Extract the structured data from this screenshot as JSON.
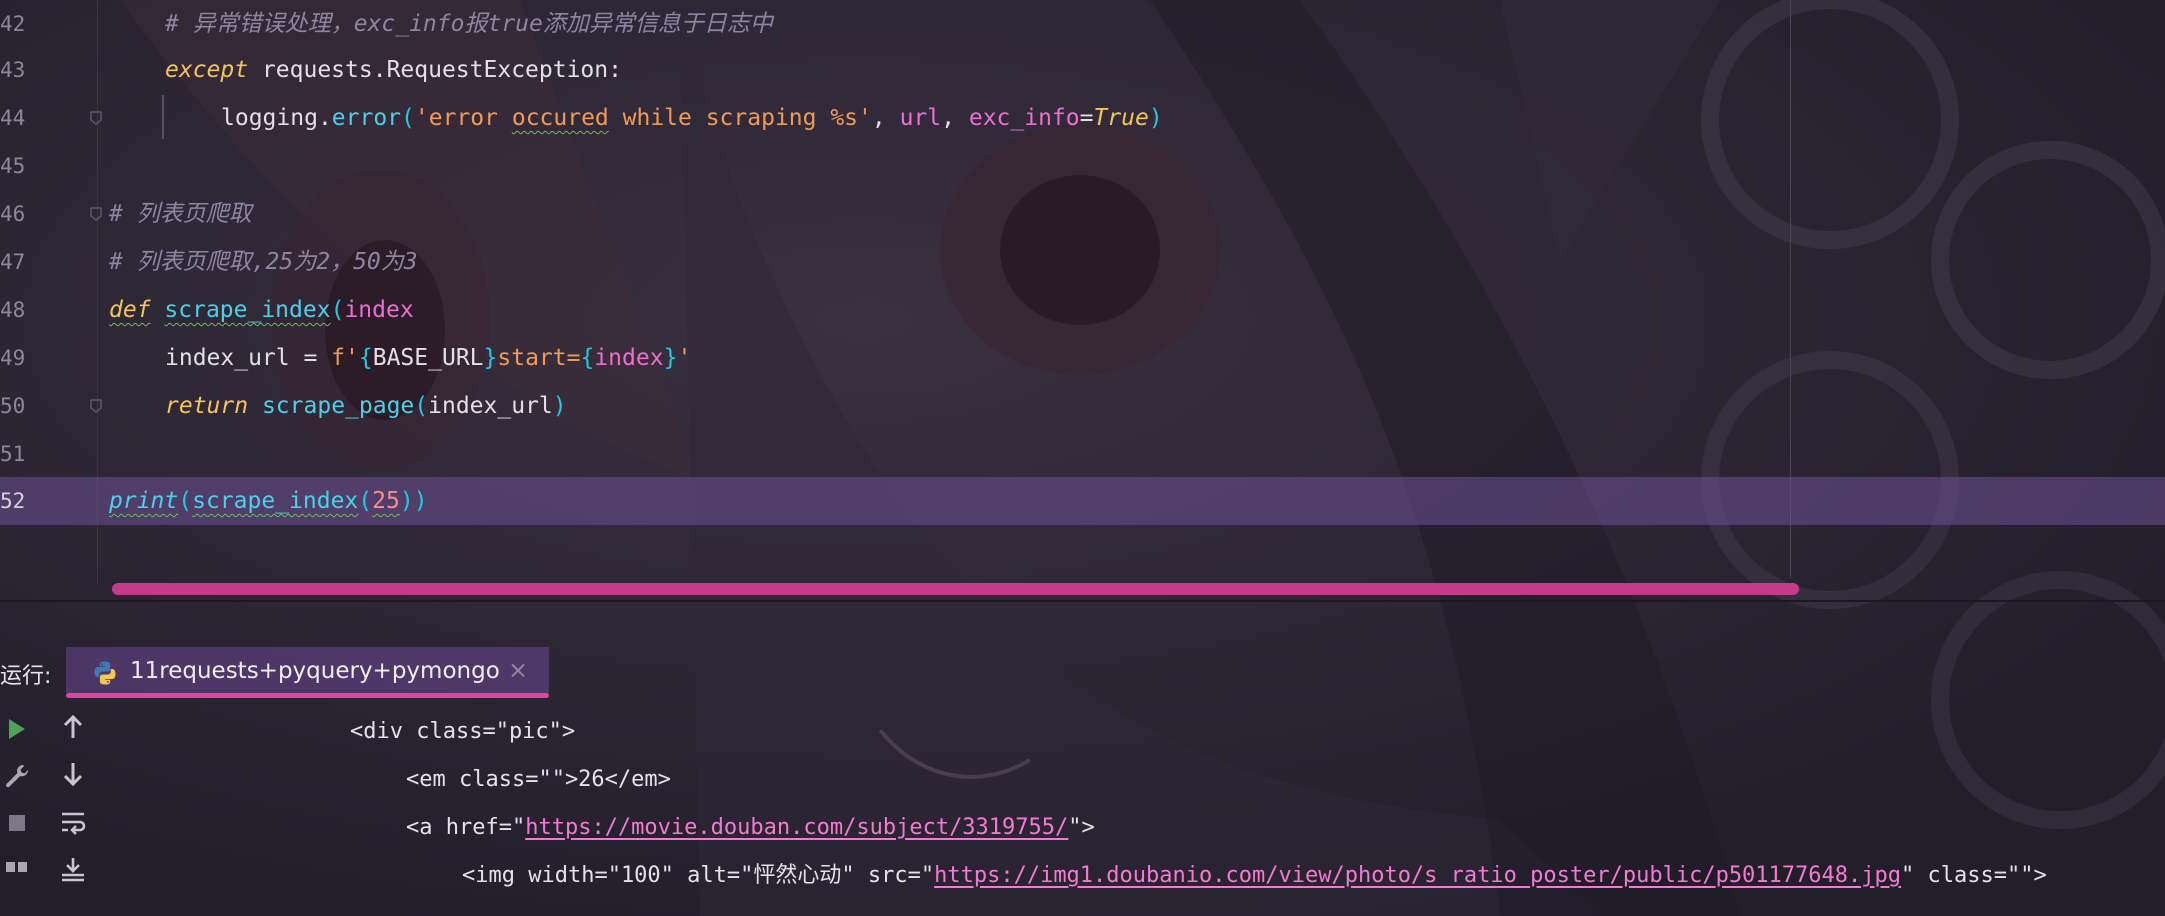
{
  "editor": {
    "lines": [
      {
        "num": "42",
        "tokens": [
          [
            "# 异常错误处理，exc_info报true添加异常信息于日志中",
            "cm"
          ]
        ]
      },
      {
        "num": "43",
        "tokens": [
          [
            "except",
            "kw"
          ],
          [
            " requests.RequestException",
            "tx"
          ],
          [
            ":",
            "pn"
          ]
        ]
      },
      {
        "num": "44",
        "tokens": [
          [
            "logging",
            "tx"
          ],
          [
            ".",
            "pn"
          ],
          [
            "error",
            "fn"
          ],
          [
            "(",
            "br"
          ],
          [
            "'error ",
            "st"
          ],
          [
            "occured",
            "st-sq"
          ],
          [
            " while scraping %s'",
            "st"
          ],
          [
            ", ",
            "pn"
          ],
          [
            "url",
            "ex"
          ],
          [
            ", ",
            "pn"
          ],
          [
            "exc_info",
            "ex"
          ],
          [
            "=",
            "pn"
          ],
          [
            "True",
            "tr"
          ],
          [
            ")",
            "br"
          ]
        ]
      },
      {
        "num": "45",
        "tokens": []
      },
      {
        "num": "46",
        "tokens": [
          [
            "# 列表页爬取",
            "cm"
          ]
        ]
      },
      {
        "num": "47",
        "tokens": [
          [
            "# 列表页爬取,25为2，50为3",
            "cm"
          ]
        ]
      },
      {
        "num": "48",
        "tokens": [
          [
            "def",
            "kw-sq"
          ],
          [
            " ",
            "tx"
          ],
          [
            "scrape_index",
            "fn-sq"
          ],
          [
            "(",
            "br"
          ],
          [
            "index",
            "ex"
          ],
          ")",
          "br"
        ]
      },
      {
        "num": "49",
        "tokens": [
          [
            "index_url = ",
            "tx"
          ],
          [
            "f'",
            "st"
          ],
          [
            "{",
            "br"
          ],
          [
            "BASE_URL",
            "tx"
          ],
          [
            "}",
            "br"
          ],
          [
            "start=",
            "st"
          ],
          [
            "{",
            "br"
          ],
          [
            "index",
            "ex"
          ],
          [
            "}",
            "br"
          ],
          [
            "'",
            "st"
          ]
        ]
      },
      {
        "num": "50",
        "tokens": [
          [
            "return",
            "kw"
          ],
          [
            " ",
            "tx"
          ],
          [
            "scrape_page",
            "fn"
          ],
          [
            "(",
            "br"
          ],
          [
            "index_url",
            "tx"
          ],
          [
            ")",
            "br"
          ]
        ]
      },
      {
        "num": "51",
        "tokens": []
      },
      {
        "num": "52",
        "tokens": [
          [
            "print",
            "fn-sq-it"
          ],
          [
            "(",
            "br"
          ],
          [
            "scrape_index",
            "fn-sq"
          ],
          [
            "(",
            "br"
          ],
          [
            "25",
            "nm-sq"
          ],
          [
            "))",
            "br"
          ]
        ]
      }
    ]
  },
  "run_panel": {
    "label": "运行:",
    "tab_title": "11requests+pyquery+pymongo",
    "close_glyph": "×",
    "output": [
      {
        "indent": 0,
        "parts": [
          [
            "<div class=\"pic\">",
            "t"
          ]
        ]
      },
      {
        "indent": 1,
        "parts": [
          [
            "<em class=\"\">26</em>",
            "t"
          ]
        ]
      },
      {
        "indent": 1,
        "parts": [
          [
            "<a href=\"",
            "t"
          ],
          [
            "https://movie.douban.com/subject/3319755/",
            "l"
          ],
          [
            "\">",
            "t"
          ]
        ]
      },
      {
        "indent": 2,
        "parts": [
          [
            "<img width=\"100\" alt=\"怦然心动\" src=\"",
            "t"
          ],
          [
            "https://img1.doubanio.com/view/photo/s_ratio_poster/public/p501177648.jpg",
            "l"
          ],
          [
            "\" class=\"\">",
            "t"
          ]
        ]
      }
    ],
    "tools": [
      "run-icon",
      "wrench-icon",
      "stop-icon",
      "layout-icon",
      "up-arrow-icon",
      "down-arrow-icon",
      "soft-wrap-icon",
      "scroll-to-end-icon"
    ]
  },
  "colors": {
    "comment": "#8e86a1",
    "keyword": "#f2c55c",
    "function": "#4bd0e8",
    "string": "#f19a57",
    "param": "#ec6fd0",
    "number": "#ff8a8a",
    "link": "#f27ad2",
    "accent": "#e0449f",
    "current_line": "#6e5096"
  }
}
